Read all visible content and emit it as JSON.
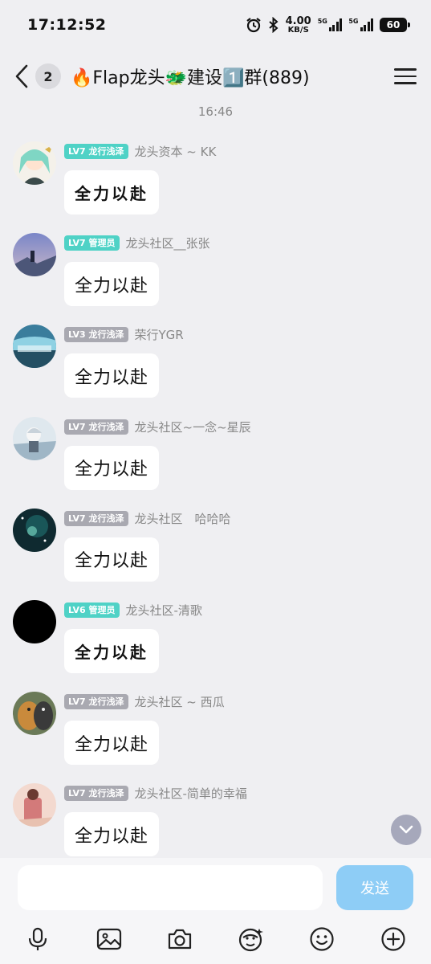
{
  "status": {
    "time": "17:12:52",
    "speed_value": "4.00",
    "speed_unit": "KB/S",
    "sim1_label": "5G",
    "sim2_label": "5G",
    "battery": "60"
  },
  "header": {
    "unread_count": "2",
    "title": "🔥Flap龙头🐲建设1️⃣群(889)"
  },
  "chat": {
    "timestamp": "16:46",
    "messages": [
      {
        "level": "LV7 龙行浅泽",
        "sender": "龙头资本 ~ KK",
        "text": "全力以赴",
        "badge_color": "#4fd2c6"
      },
      {
        "level": "LV7 管理员",
        "sender": "龙头社区__张张",
        "text": "全力以赴",
        "badge_color": "#4fd2c6"
      },
      {
        "level": "LV3 龙行浅泽",
        "sender": "荣行YGR",
        "text": "全力以赴",
        "badge_color": "#a9a9b1"
      },
      {
        "level": "LV7 龙行浅泽",
        "sender": "龙头社区~一念~星辰",
        "text": "全力以赴",
        "badge_color": "#a9a9b1"
      },
      {
        "level": "LV7 龙行浅泽",
        "sender": "龙头社区　哈哈哈",
        "text": "全力以赴",
        "badge_color": "#a9a9b1"
      },
      {
        "level": "LV6 管理员",
        "sender": "龙头社区-清歌",
        "text": "全力以赴",
        "badge_color": "#4fd2c6"
      },
      {
        "level": "LV7 龙行浅泽",
        "sender": "龙头社区 ~ 西瓜",
        "text": "全力以赴",
        "badge_color": "#a9a9b1"
      },
      {
        "level": "LV7 龙行浅泽",
        "sender": "龙头社区-简单的幸福",
        "text": "全力以赴",
        "badge_color": "#a9a9b1"
      }
    ]
  },
  "composer": {
    "input_value": "",
    "send_label": "发送"
  },
  "toolbar": {
    "icons": [
      "microphone-icon",
      "image-icon",
      "camera-icon",
      "sticker-icon",
      "emoji-icon",
      "plus-icon"
    ]
  },
  "colors": {
    "accent": "#8ecdf6",
    "badge_admin": "#4fd2c6",
    "badge_member": "#a9a9b1"
  }
}
